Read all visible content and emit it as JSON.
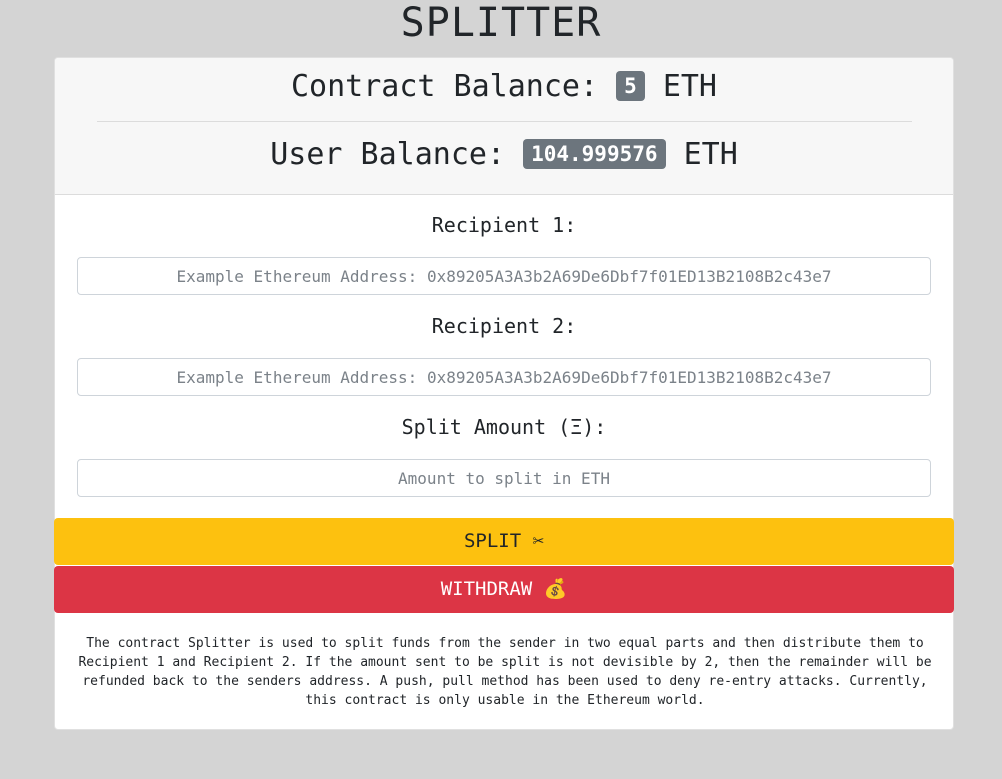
{
  "app": {
    "title": "SPLITTER"
  },
  "balances": {
    "contract_label": "Contract Balance:",
    "contract_value": "5",
    "user_label": "User Balance:",
    "user_value": "104.999576",
    "unit": "ETH"
  },
  "form": {
    "recipient1_label": "Recipient 1:",
    "recipient1_placeholder": "Example Ethereum Address: 0x89205A3A3b2A69De6Dbf7f01ED13B2108B2c43e7",
    "recipient1_value": "",
    "recipient2_label": "Recipient 2:",
    "recipient2_placeholder": "Example Ethereum Address: 0x89205A3A3b2A69De6Dbf7f01ED13B2108B2c43e7",
    "recipient2_value": "",
    "amount_label": "Split Amount (Ξ):",
    "amount_placeholder": "Amount to split in ETH",
    "amount_value": ""
  },
  "actions": {
    "split_label": "SPLIT ✂",
    "withdraw_label": "WITHDRAW 💰"
  },
  "description": "The contract Splitter is used to split funds from the sender in two equal parts and then distribute them to Recipient 1 and Recipient 2. If the amount sent to be split is not devisible by 2, then the remainder will be refunded back to the senders address. A push, pull method has been used to deny re-entry attacks. Currently, this contract is only usable in the Ethereum world.",
  "colors": {
    "background": "#d4d4d4",
    "badge": "#6c757d",
    "split_button": "#fdc10f",
    "withdraw_button": "#dc3545"
  }
}
